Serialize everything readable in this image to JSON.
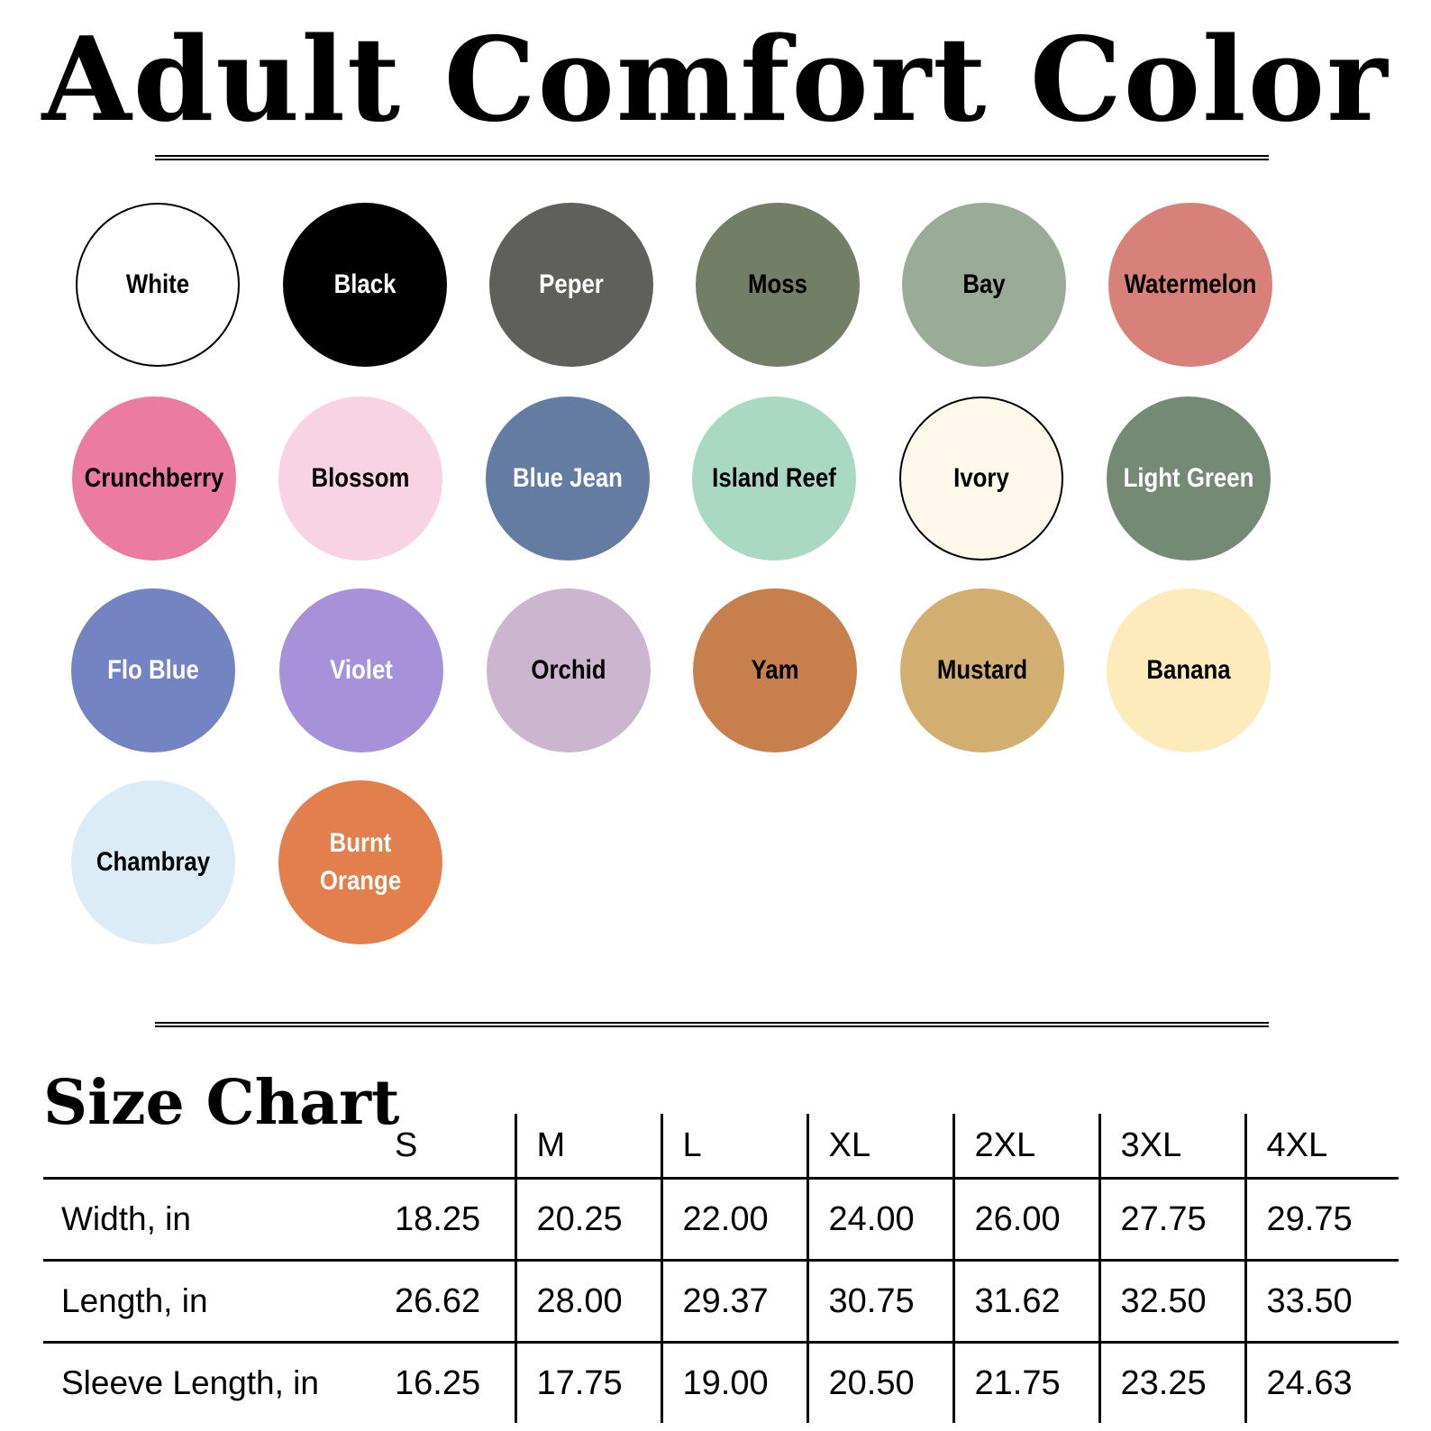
{
  "title": "Adult Comfort Color",
  "swatches": [
    {
      "label": "White",
      "color": "#ffffff",
      "text_color": "#000000"
    },
    {
      "label": "Black",
      "color": "#000000",
      "text_color": "#ffffff"
    },
    {
      "label": "Peper",
      "color": "#5f605b",
      "text_color": "#ffffff"
    },
    {
      "label": "Moss",
      "color": "#737e66",
      "text_color": "#000000"
    },
    {
      "label": "Bay",
      "color": "#9aab98",
      "text_color": "#000000"
    },
    {
      "label": "Watermelon",
      "color": "#d8807a",
      "text_color": "#000000"
    },
    {
      "label": "Crunchberry",
      "color": "#ec7ba1",
      "text_color": "#000000"
    },
    {
      "label": "Blossom",
      "color": "#f7d3e4",
      "text_color": "#000000"
    },
    {
      "label": "Blue Jean",
      "color": "#647ca1",
      "text_color": "#ffffff"
    },
    {
      "label": "Island Reef",
      "color": "#a9d8c3",
      "text_color": "#000000"
    },
    {
      "label": "Ivory",
      "color": "#fef8eb",
      "text_color": "#000000"
    },
    {
      "label": "Light Green",
      "color": "#748a74",
      "text_color": "#ffffff"
    },
    {
      "label": "Flo Blue",
      "color": "#7484c2",
      "text_color": "#ffffff"
    },
    {
      "label": "Violet",
      "color": "#a791d8",
      "text_color": "#ffffff"
    },
    {
      "label": "Orchid",
      "color": "#cbb5cf",
      "text_color": "#000000"
    },
    {
      "label": "Yam",
      "color": "#c87f4e",
      "text_color": "#000000"
    },
    {
      "label": "Mustard",
      "color": "#d2ae70",
      "text_color": "#000000"
    },
    {
      "label": "Banana",
      "color": "#feebbb",
      "text_color": "#000000"
    },
    {
      "label": "Chambray",
      "color": "#dbecf7",
      "text_color": "#000000"
    },
    {
      "label": "Burnt Orange",
      "color": "#e37e4d",
      "text_color": "#ffffff"
    }
  ],
  "size_chart": {
    "title": "Size Chart",
    "sizes": [
      "S",
      "M",
      "L",
      "XL",
      "2XL",
      "3XL",
      "4XL"
    ],
    "rows": [
      {
        "label": "Width, in",
        "values": [
          "18.25",
          "20.25",
          "22.00",
          "24.00",
          "26.00",
          "27.75",
          "29.75"
        ]
      },
      {
        "label": "Length, in",
        "values": [
          "26.62",
          "28.00",
          "29.37",
          "30.75",
          "31.62",
          "32.50",
          "33.50"
        ]
      },
      {
        "label": "Sleeve Length, in",
        "values": [
          "16.25",
          "17.75",
          "19.00",
          "20.50",
          "21.75",
          "23.25",
          "24.63"
        ]
      }
    ]
  }
}
